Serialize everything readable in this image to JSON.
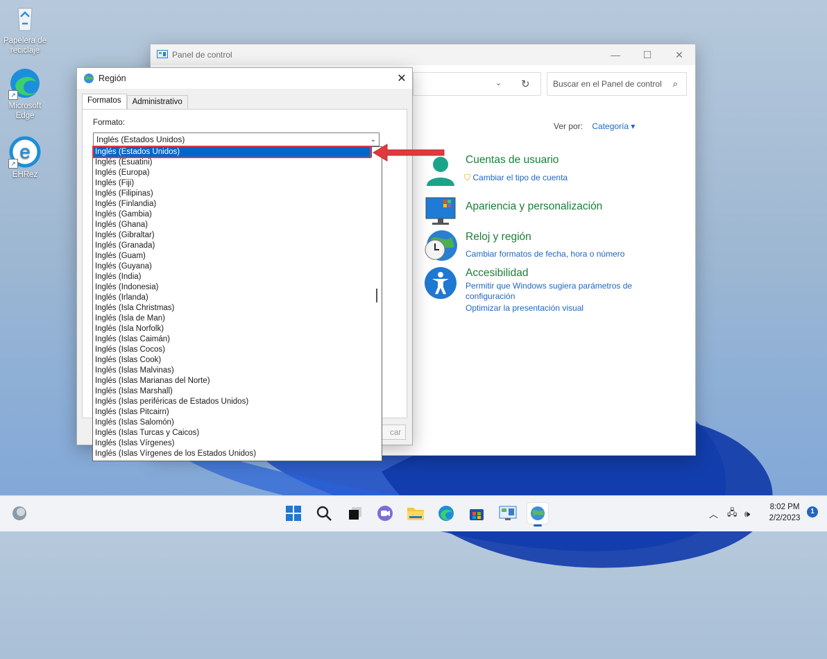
{
  "desktop": {
    "icons": [
      {
        "label": "Papelera de reciclaje",
        "icon": "recycle-bin-icon"
      },
      {
        "label": "Microsoft Edge",
        "icon": "edge-icon"
      },
      {
        "label": "EHRez",
        "icon": "ie-style-e-icon"
      }
    ]
  },
  "control_panel": {
    "title": "Panel de control",
    "search_placeholder": "Buscar en el Panel de control",
    "view_by_label": "Ver por:",
    "view_by_value": "Categoría",
    "categories": [
      {
        "title": "Cuentas de usuario",
        "links": [
          "Cambiar el tipo de cuenta"
        ],
        "icon": "user-accounts-icon"
      },
      {
        "title": "Apariencia y personalización",
        "links": [],
        "icon": "appearance-icon"
      },
      {
        "title": "Reloj y región",
        "links": [
          "Cambiar formatos de fecha, hora o número"
        ],
        "icon": "clock-region-icon"
      },
      {
        "title": "Accesibilidad",
        "links": [
          "Permitir que Windows sugiera parámetros de",
          "configuración",
          "Optimizar la presentación visual"
        ],
        "icon": "accessibility-icon"
      }
    ]
  },
  "region_dialog": {
    "title": "Región",
    "tabs": [
      "Formatos",
      "Administrativo"
    ],
    "format_label": "Formato:",
    "selected_format": "Inglés (Estados Unidos)",
    "cancel_label": "car",
    "dropdown_items": [
      "Inglés (Estados Unidos)",
      "Inglés (Esuatini)",
      "Inglés (Europa)",
      "Inglés (Fiji)",
      "Inglés (Filipinas)",
      "Inglés (Finlandia)",
      "Inglés (Gambia)",
      "Inglés (Ghana)",
      "Inglés (Gibraltar)",
      "Inglés (Granada)",
      "Inglés (Guam)",
      "Inglés (Guyana)",
      "Inglés (India)",
      "Inglés (Indonesia)",
      "Inglés (Irlanda)",
      "Inglés (Isla Christmas)",
      "Inglés (Isla de Man)",
      "Inglés (Isla Norfolk)",
      "Inglés (Islas Caimán)",
      "Inglés (Islas Cocos)",
      "Inglés (Islas Cook)",
      "Inglés (Islas Malvinas)",
      "Inglés (Islas Marianas del Norte)",
      "Inglés (Islas Marshall)",
      "Inglés (Islas periféricas de Estados Unidos)",
      "Inglés (Islas Pitcairn)",
      "Inglés (Islas Salomón)",
      "Inglés (Islas Turcas y Caicos)",
      "Inglés (Islas Vírgenes)",
      "Inglés (Islas Vírgenes de los Estados Unidos)"
    ]
  },
  "taskbar": {
    "apps": [
      "start-icon",
      "search-icon",
      "task-view-icon",
      "teams-chat-icon",
      "file-explorer-icon",
      "edge-icon",
      "store-icon",
      "control-panel-icon",
      "region-globe-icon"
    ],
    "time": "8:02 PM",
    "date": "2/2/2023",
    "notification_count": "1"
  },
  "colors": {
    "accent": "#0066cc",
    "highlight_red": "#e0393e",
    "link_blue": "#1f66c2",
    "category_green": "#1a7f37"
  }
}
